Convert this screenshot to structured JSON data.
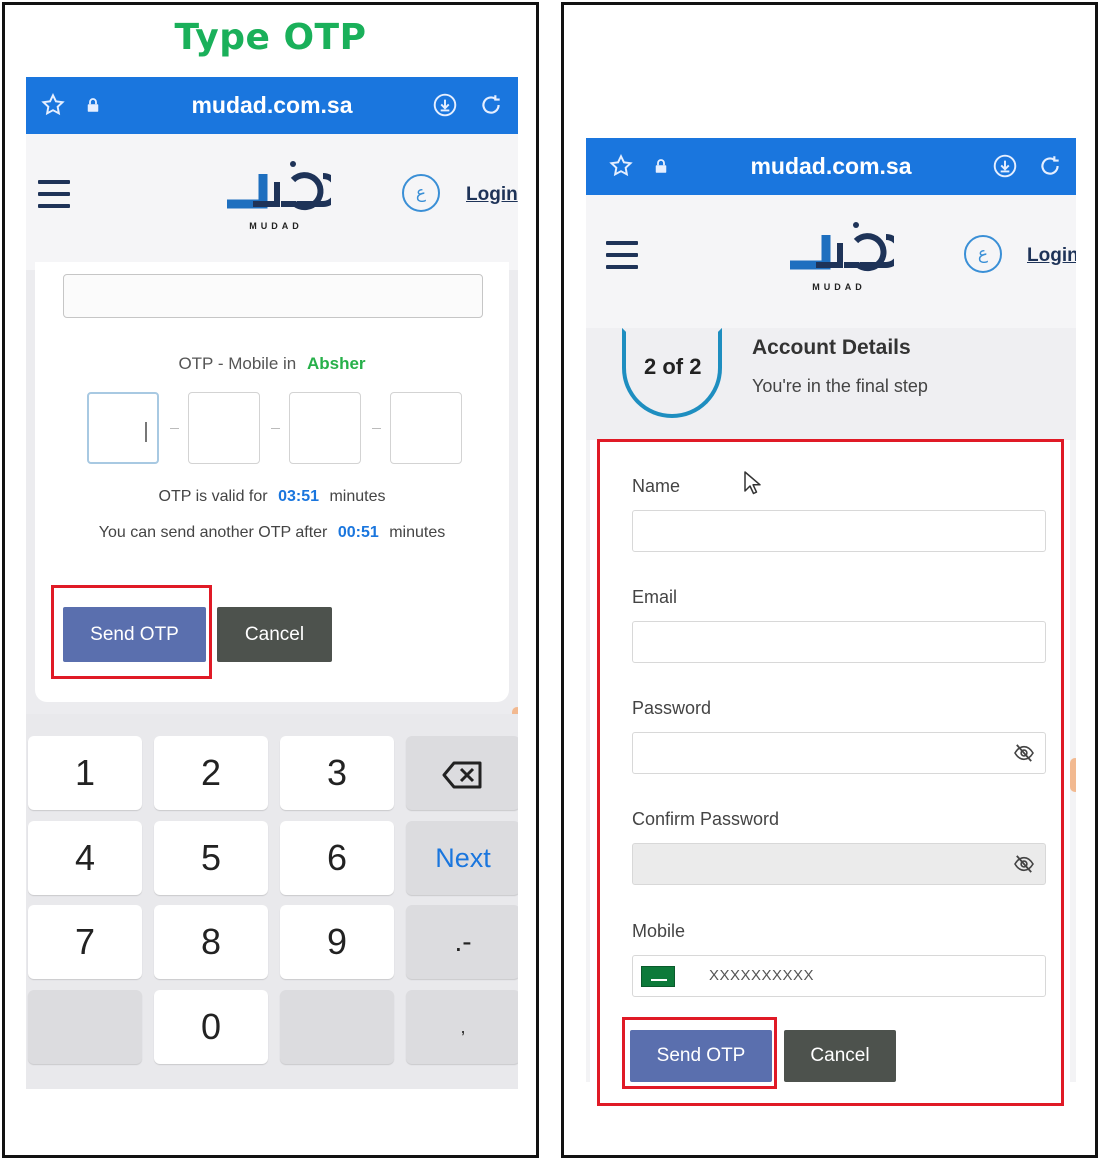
{
  "caption": "Type OTP",
  "browser": {
    "url": "mudad.com.sa"
  },
  "header": {
    "logo_tag": "MUDAD",
    "lang_label": "ع",
    "login": "Login"
  },
  "otp": {
    "label": "OTP - Mobile in",
    "brand": "Absher",
    "valid_prefix": "OTP is valid for",
    "valid_time": "03:51",
    "valid_suffix": "minutes",
    "resend_prefix": "You can send another OTP after",
    "resend_time": "00:51",
    "resend_suffix": "minutes",
    "send_button": "Send OTP",
    "cancel_button": "Cancel"
  },
  "keypad": {
    "k1": "1",
    "k2": "2",
    "k3": "3",
    "k4": "4",
    "k5": "5",
    "k6": "6",
    "k7": "7",
    "k8": "8",
    "k9": "9",
    "k0": "0",
    "next": "Next",
    "dotdash": ".-",
    "comma": ","
  },
  "step": {
    "counter": "2 of 2",
    "title": "Account Details",
    "subtitle": "You're in the final step"
  },
  "form": {
    "name_label": "Name",
    "email_label": "Email",
    "password_label": "Password",
    "confirm_label": "Confirm Password",
    "mobile_label": "Mobile",
    "mobile_value": "XXXXXXXXXX",
    "send_button": "Send OTP",
    "cancel_button": "Cancel"
  },
  "colors": {
    "caption": "#1ab05a",
    "browser_bar": "#1a76de",
    "primary_button": "#5a6fae",
    "secondary_button": "#4d524d",
    "highlight_frame": "#e01a26",
    "absher": "#27b04a"
  },
  "icons": {
    "bookmark": "star-icon",
    "secure": "lock-icon",
    "download": "download-icon",
    "reload": "reload-icon",
    "menu": "hamburger-icon",
    "backspace": "backspace-icon",
    "visibility": "eye-off-icon"
  }
}
